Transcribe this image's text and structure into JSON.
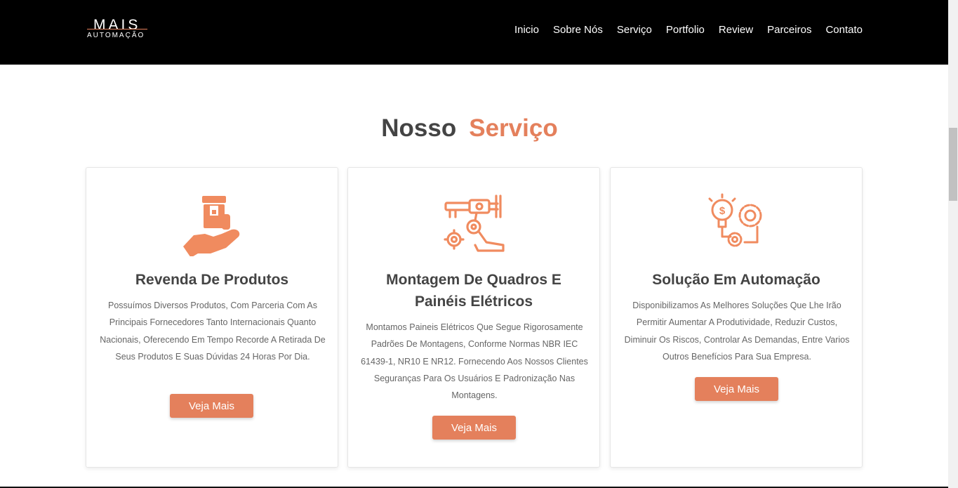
{
  "brand": {
    "main": "MAIS",
    "sub": "AUTOMAÇÃO",
    "accent_color": "#e4805c"
  },
  "nav": {
    "items": [
      {
        "label": "Inicio"
      },
      {
        "label": "Sobre Nós"
      },
      {
        "label": "Serviço"
      },
      {
        "label": "Portfolio"
      },
      {
        "label": "Review"
      },
      {
        "label": "Parceiros"
      },
      {
        "label": "Contato"
      }
    ]
  },
  "section": {
    "title_plain": "Nosso",
    "title_accent": "Serviço"
  },
  "cards": [
    {
      "icon": "hand-product-icon",
      "title": "Revenda De Produtos",
      "text": "Possuímos Diversos Produtos, Com Parceria Com As Principais Fornecedores Tanto Internacionais Quanto Nacionais, Oferecendo Em Tempo Recorde A Retirada De Seus Produtos E Suas Dúvidas 24 Horas Por Dia.",
      "button": "Veja Mais"
    },
    {
      "icon": "robotic-arm-icon",
      "title": "Montagem De Quadros E Painéis Elétricos",
      "text": "Montamos Paineis Elétricos Que Segue Rigorosamente Padrões De Montagens, Conforme Normas NBR IEC 61439-1, NR10 E NR12. Fornecendo Aos Nossos Clientes Seguranças Para Os Usuários E Padronização Nas Montagens.",
      "button": "Veja Mais"
    },
    {
      "icon": "idea-gears-icon",
      "title": "Solução Em Automação",
      "text": "Disponibilizamos As Melhores Soluções Que Lhe Irão Permitir Aumentar A Produtividade, Reduzir Custos, Diminuir Os Riscos, Controlar As Demandas, Entre Varios Outros Benefícios Para Sua Empresa.",
      "button": "Veja Mais"
    }
  ]
}
